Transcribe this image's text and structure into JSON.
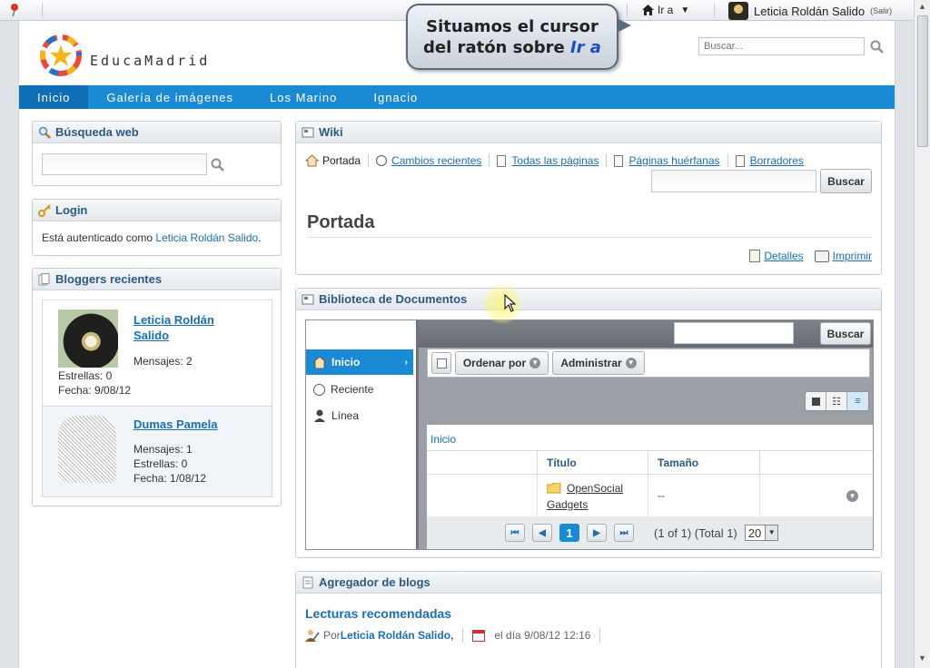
{
  "dockbar": {
    "goto_label": "Ir a",
    "user_name": "Leticia Roldán Salido",
    "logout_label": "(Salir)"
  },
  "callout": {
    "line1": "Situamos el cursor",
    "line2_prefix": "del ratón sobre ",
    "line2_em": "Ir a"
  },
  "header": {
    "logo_text": "EducaMadrid",
    "search_placeholder": "Buscar..."
  },
  "nav": {
    "items": [
      "Inicio",
      "Galería de imágenes",
      "Los Marino",
      "Ignacio"
    ],
    "active_index": 0
  },
  "web_search": {
    "title": "Búsqueda web"
  },
  "login": {
    "title": "Login",
    "text": "Está autenticado como ",
    "user_link": "Leticia Roldán Salido",
    "suffix": "."
  },
  "bloggers": {
    "title": "Bloggers recientes",
    "items": [
      {
        "name_line1": "Leticia Roldán",
        "name_line2": "Salido",
        "messages": "Mensajes: 2",
        "stars": "Estrellas: 0",
        "date": "Fecha: 9/08/12"
      },
      {
        "name_line1": "Dumas Pamela",
        "name_line2": "",
        "messages": "Mensajes: 1",
        "stars": "Estrellas: 0",
        "date": "Fecha: 1/08/12"
      }
    ]
  },
  "wiki": {
    "title": "Wiki",
    "tabs": [
      "Portada",
      "Cambios recientes",
      "Todas las páginas",
      "Páginas huérfanas",
      "Borradores"
    ],
    "search_button": "Buscar",
    "page_title": "Portada",
    "details_link": "Detalles",
    "print_link": "Imprimir"
  },
  "doclib": {
    "title": "Biblioteca de Documentos",
    "search_button": "Buscar",
    "sidebar": [
      "Inicio",
      "Reciente",
      "Línea"
    ],
    "order_button": "Ordenar por",
    "admin_button": "Administrar",
    "breadcrumb": "Inicio",
    "columns": [
      "",
      "Título",
      "Tamaño",
      ""
    ],
    "row": {
      "title_line1": "OpenSocial",
      "title_line2": "Gadgets",
      "size": "--"
    },
    "pagination": {
      "current_page": "1",
      "info": "(1 of 1) (Total 1)",
      "page_size": "20"
    }
  },
  "blogs": {
    "title": "Agregador de blogs",
    "entry_title": "Lecturas recomendadas",
    "by_label": "Por ",
    "author": "Leticia Roldán Salido,",
    "date": "el día 9/08/12 12:16"
  },
  "colors": {
    "nav_blue": "#1a8ad4",
    "link_blue": "#1a6fb5",
    "header_blue_text": "#2b5a85",
    "cursor_highlight": "#fff59a"
  }
}
